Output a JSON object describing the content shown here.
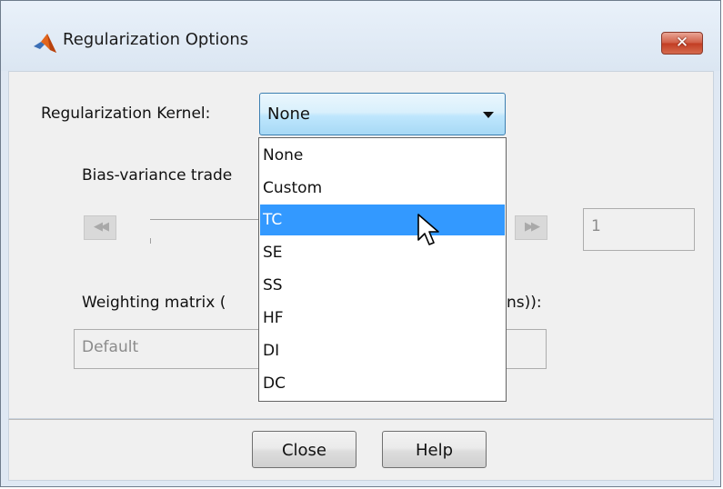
{
  "window": {
    "title": "Regularization Options",
    "close_glyph": "✕"
  },
  "form": {
    "kernel_label": "Regularization Kernel:",
    "kernel_value": "None",
    "bias_label": "Bias-variance trade",
    "bias_label_right": "",
    "bias_value": "1",
    "weighting_label": "Weighting matrix (",
    "weighting_label_right": "ns)):",
    "weighting_value": "Default"
  },
  "dropdown": {
    "options": [
      "None",
      "Custom",
      "TC",
      "SE",
      "SS",
      "HF",
      "DI",
      "DC"
    ],
    "selected": "TC"
  },
  "buttons": {
    "close_label": "Close",
    "help_label": "Help"
  },
  "stepper": {
    "left_glyph": "◀◀",
    "right_glyph": "▶▶"
  },
  "colors": {
    "selection": "#3399ff",
    "close_button": "#c23c22"
  },
  "icons": {
    "app": "matlab-logo-icon",
    "cursor": "mouse-pointer-icon"
  }
}
